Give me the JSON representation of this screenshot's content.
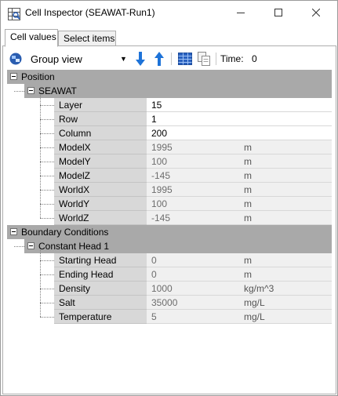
{
  "window": {
    "title": "Cell Inspector (SEAWAT-Run1)",
    "icon": "cell-inspector-icon",
    "controls": {
      "minimize": "minimize-icon",
      "maximize": "maximize-icon",
      "close": "close-icon"
    }
  },
  "tabs": [
    {
      "label": "Cell values",
      "active": true
    },
    {
      "label": "Select items",
      "active": false
    }
  ],
  "toolbar": {
    "group_view_label": "Group view",
    "time_label": "Time:",
    "time_value": "0",
    "icons": [
      "group-view-icon",
      "dropdown-arrow-icon",
      "move-down-icon",
      "move-up-icon",
      "grid-view-icon",
      "copy-icon"
    ]
  },
  "grid": {
    "categories": [
      {
        "label": "Position",
        "groups": [
          {
            "label": "SEAWAT",
            "rows": [
              {
                "name": "Layer",
                "value": "15",
                "unit": "",
                "editable": true
              },
              {
                "name": "Row",
                "value": "1",
                "unit": "",
                "editable": true
              },
              {
                "name": "Column",
                "value": "200",
                "unit": "",
                "editable": true
              },
              {
                "name": "ModelX",
                "value": "1995",
                "unit": "m",
                "editable": false
              },
              {
                "name": "ModelY",
                "value": "100",
                "unit": "m",
                "editable": false
              },
              {
                "name": "ModelZ",
                "value": "-145",
                "unit": "m",
                "editable": false
              },
              {
                "name": "WorldX",
                "value": "1995",
                "unit": "m",
                "editable": false
              },
              {
                "name": "WorldY",
                "value": "100",
                "unit": "m",
                "editable": false
              },
              {
                "name": "WorldZ",
                "value": "-145",
                "unit": "m",
                "editable": false
              }
            ]
          }
        ]
      },
      {
        "label": "Boundary Conditions",
        "groups": [
          {
            "label": "Constant Head 1",
            "rows": [
              {
                "name": "Starting Head",
                "value": "0",
                "unit": "m",
                "editable": false
              },
              {
                "name": "Ending Head",
                "value": "0",
                "unit": "m",
                "editable": false
              },
              {
                "name": "Density",
                "value": "1000",
                "unit": "kg/m^3",
                "editable": false
              },
              {
                "name": "Salt",
                "value": "35000",
                "unit": "mg/L",
                "editable": false
              },
              {
                "name": "Temperature",
                "value": "5",
                "unit": "mg/L",
                "editable": false
              }
            ]
          }
        ]
      }
    ]
  },
  "colors": {
    "category_bg": "#a9a9a9",
    "name_cell_bg": "#d8d8d8",
    "readonly_bg": "#f0f0f0",
    "accent_blue": "#1e73d8"
  }
}
